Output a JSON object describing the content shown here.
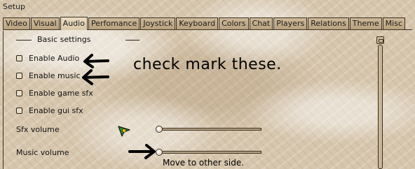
{
  "window": {
    "title": "Setup"
  },
  "tabs": [
    {
      "label": "Video"
    },
    {
      "label": "Visual"
    },
    {
      "label": "Audio"
    },
    {
      "label": "Perfomance"
    },
    {
      "label": "Joystick"
    },
    {
      "label": "Keyboard"
    },
    {
      "label": "Colors"
    },
    {
      "label": "Chat"
    },
    {
      "label": "Players"
    },
    {
      "label": "Relations"
    },
    {
      "label": "Theme"
    },
    {
      "label": "Misc"
    }
  ],
  "active_tab": "Audio",
  "basic_settings": {
    "heading": "Basic settings",
    "options": [
      {
        "label": "Enable Audio",
        "checked": false
      },
      {
        "label": "Enable music",
        "checked": false
      },
      {
        "label": "Enable game sfx",
        "checked": false
      },
      {
        "label": "Enable gui sfx",
        "checked": false
      }
    ]
  },
  "sliders": [
    {
      "label": "Sfx volume",
      "level": 0
    },
    {
      "label": "Music volume",
      "level": 0
    }
  ],
  "annotations": {
    "check_note": "check mark these.",
    "slider_note": "Move to other side."
  },
  "icons": {
    "arrows": "left-arrow-icon / right-arrow-icon",
    "cursor": "cursor-icon"
  }
}
